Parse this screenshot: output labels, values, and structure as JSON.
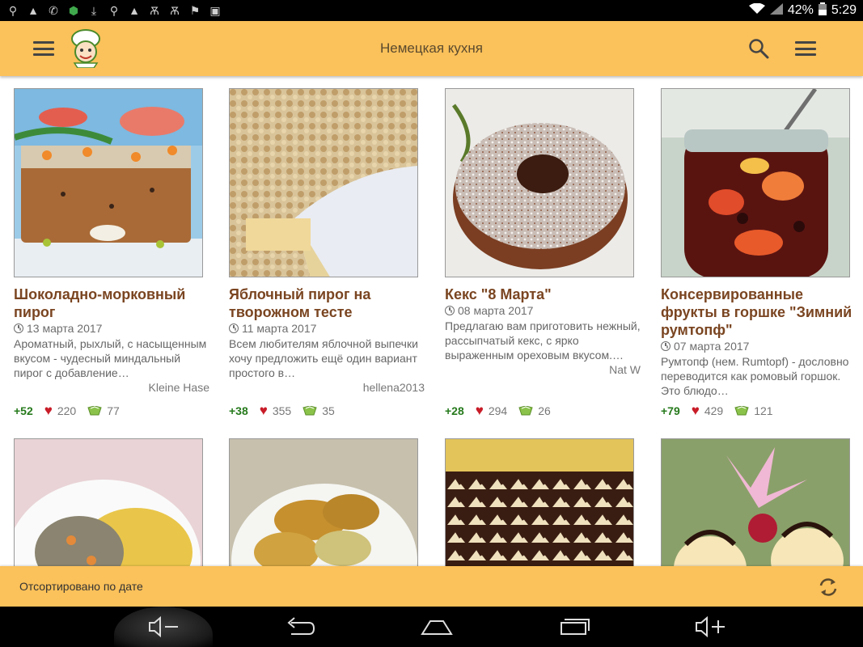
{
  "status_bar": {
    "left_icons": [
      "usb-icon",
      "warning-icon",
      "viber-icon",
      "shield-icon",
      "download-icon",
      "search-icon",
      "warning-icon",
      "ok-icon",
      "ok-icon",
      "location-icon",
      "image-icon"
    ],
    "battery": "42%",
    "time": "5:29"
  },
  "app_bar": {
    "title": "Немецкая кухня",
    "menu_icon": "hamburger-icon",
    "logo": "chef-logo",
    "search_icon": "search-icon",
    "overflow_icon": "hamburger-icon"
  },
  "recipes": [
    {
      "title": "Шоколадно-морковный пирог",
      "date": "13 марта 2017",
      "description": "Ароматный, рыхлый, с насыщенным вкусом - чудесный миндальный пирог с добавление…",
      "author": "Kleine Hase",
      "rating": "+52",
      "likes": "220",
      "comments": "77"
    },
    {
      "title": "Яблочный пирог на творожном тесте",
      "date": "11 марта 2017",
      "description": "Всем любителям яблочной выпечки хочу предложить ещё один вариант простого в…",
      "author": "hellena2013",
      "rating": "+38",
      "likes": "355",
      "comments": "35"
    },
    {
      "title": "Кекс \"8 Марта\"",
      "date": "08 марта 2017",
      "description": "Предлагаю вам приготовить нежный, рассыпчатый кекс, с ярко выраженным ореховым вкусом.…",
      "author": "Nat W",
      "rating": "+28",
      "likes": "294",
      "comments": "26"
    },
    {
      "title": "Консервированные фрукты в горшке \"Зимний румтопф\"",
      "date": "07 марта 2017",
      "description": "Румтопф (нем. Rumtopf) - дословно переводится как ромовый горшок. Это блюдо…",
      "author": "",
      "rating": "+79",
      "likes": "429",
      "comments": "121"
    }
  ],
  "bottom_bar": {
    "sort_label": "Отсортировано по дате",
    "refresh_icon": "refresh-icon"
  },
  "nav_bar": {
    "buttons": [
      "volume-down-icon",
      "back-icon",
      "home-icon",
      "recents-icon",
      "volume-up-icon"
    ]
  },
  "colors": {
    "accent": "#fbc15a",
    "title": "#7a4521",
    "rating": "#267a1c",
    "heart": "#c81c28"
  }
}
